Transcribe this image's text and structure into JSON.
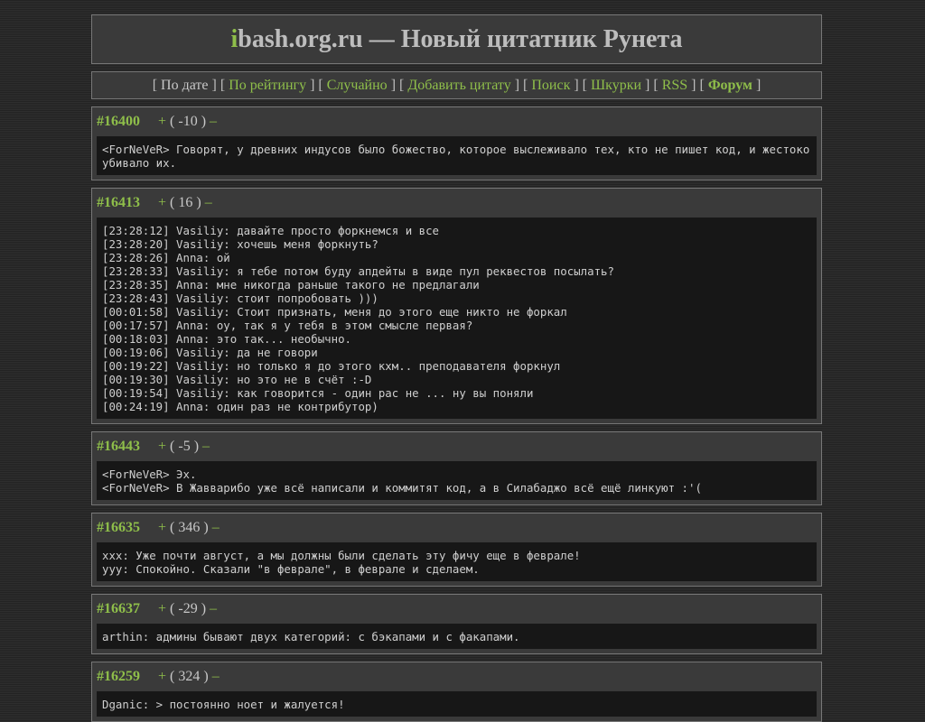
{
  "site": {
    "title_first_letter": "i",
    "title_rest": "bash.org.ru — Новый цитатник Рунета"
  },
  "nav": {
    "open": "[ ",
    "sep": " ] [ ",
    "close": " ]",
    "items": [
      {
        "label": "По дате"
      },
      {
        "label": "По рейтингу"
      },
      {
        "label": "Случайно"
      },
      {
        "label": "Добавить цитату"
      },
      {
        "label": "Поиск"
      },
      {
        "label": "Шкурки"
      },
      {
        "label": "RSS"
      },
      {
        "label": "Форум"
      }
    ]
  },
  "vote_plus": "+",
  "vote_minus": "–",
  "quotes": [
    {
      "id": "#16400",
      "rating": "( -10 )",
      "text": "<ForNeVeR> Говорят, у древних индусов было божество, которое выслеживало тех, кто не пишет код, и жестоко убивало их."
    },
    {
      "id": "#16413",
      "rating": "( 16 )",
      "text": "[23:28:12] Vasiliy: давайте просто форкнемся и все\n[23:28:20] Vasiliy: хочешь меня форкнуть?\n[23:28:26] Anna: ой\n[23:28:33] Vasiliy: я тебе потом буду апдейты в виде пул реквестов посылать?\n[23:28:35] Anna: мне никогда раньше такого не предлагали\n[23:28:43] Vasiliy: стоит попробовать )))\n[00:01:58] Vasiliy: Стоит признать, меня до этого еще никто не форкал\n[00:17:57] Anna: оу, так я у тебя в этом смысле первая?\n[00:18:03] Anna: это так... необычно.\n[00:19:06] Vasiliy: да не говори\n[00:19:22] Vasiliy: но только я до этого кхм.. преподавателя форкнул\n[00:19:30] Vasiliy: но это не в счёт :-D\n[00:19:54] Vasiliy: как говорится - один рас не ... ну вы поняли\n[00:24:19] Anna: один раз не контрибутор)"
    },
    {
      "id": "#16443",
      "rating": "( -5 )",
      "text": "<ForNeVeR> Эх.\n<ForNeVeR> В Жавварибо уже всё написали и коммитят код, а в Силабаджо всё ещё линкуют :'("
    },
    {
      "id": "#16635",
      "rating": "( 346 )",
      "text": "xxx: Уже почти август, а мы должны были сделать эту фичу еще в феврале!\nyyy: Спокойно. Сказали \"в феврале\", в феврале и сделаем."
    },
    {
      "id": "#16637",
      "rating": "( -29 )",
      "text": "arthin: админы бывают двух категорий: с бэкапами и с факапами."
    },
    {
      "id": "#16259",
      "rating": "( 324 )",
      "text": "Dganic: > постоянно ноет и жалуется!"
    }
  ]
}
